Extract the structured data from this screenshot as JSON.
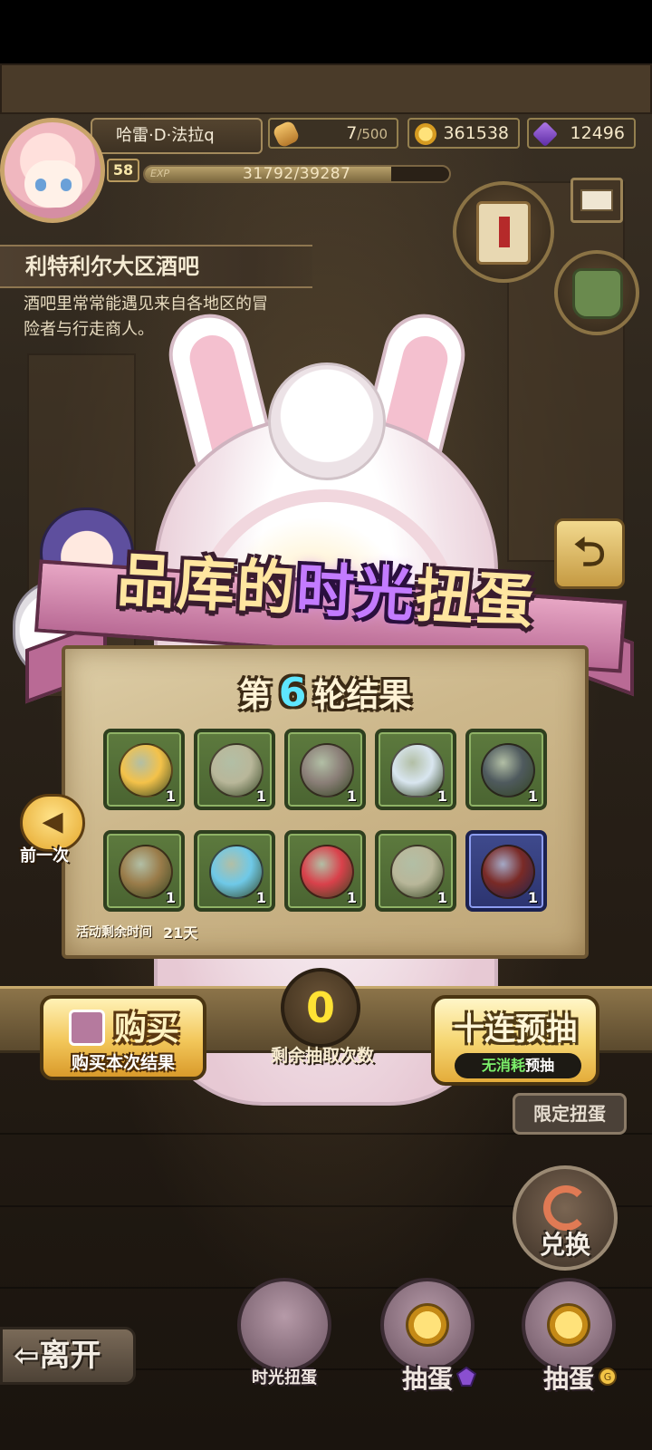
{
  "player": {
    "name": "哈雷·D·法拉q",
    "level": "58",
    "exp_label": "EXP",
    "exp_text": "31792/39287",
    "exp_fraction": 0.809
  },
  "resources": {
    "stamina": {
      "value": "7",
      "max": "/500",
      "icon": "bread-icon"
    },
    "gold": {
      "value": "361538",
      "icon": "gold-coin-icon"
    },
    "gems": {
      "value": "12496",
      "icon": "purple-gem-icon"
    }
  },
  "location": {
    "name": "利特利尔大区酒吧",
    "description_line1": "酒吧里常常能遇见来自各地区的冒",
    "description_line2": "险者与行走商人。"
  },
  "banner": {
    "part1": "品库的",
    "part2": "时光",
    "part3": "扭蛋"
  },
  "result": {
    "prefix": "第",
    "round": "6",
    "suffix": "轮结果",
    "items": [
      {
        "name": "golden-egg",
        "qty": "1",
        "rare": false,
        "color": "#f4c24a"
      },
      {
        "name": "leaf-shell",
        "qty": "1",
        "rare": false,
        "color": "#b9b79a"
      },
      {
        "name": "fur-hood",
        "qty": "1",
        "rare": false,
        "color": "#8b7f78"
      },
      {
        "name": "glass-flask",
        "qty": "1",
        "rare": false,
        "color": "#d9e6f0"
      },
      {
        "name": "turtle-shell",
        "qty": "1",
        "rare": false,
        "color": "#4f5a5e"
      },
      {
        "name": "wooden-egg",
        "qty": "1",
        "rare": false,
        "color": "#9a7c4a"
      },
      {
        "name": "blue-spiral-egg",
        "qty": "1",
        "rare": false,
        "color": "#6fc9e8"
      },
      {
        "name": "red-egg",
        "qty": "1",
        "rare": false,
        "color": "#d9414b"
      },
      {
        "name": "leaf-shell",
        "qty": "1",
        "rare": false,
        "color": "#b9b79a"
      },
      {
        "name": "flame-fur",
        "qty": "1",
        "rare": true,
        "color": "#7a2a26"
      }
    ],
    "remaining_label": "活动剩余时间",
    "remaining_value": "21天"
  },
  "prev_button": {
    "label": "前一次"
  },
  "buy_button": {
    "title": "购买",
    "subtitle": "购买本次结果"
  },
  "counter": {
    "value": "0",
    "label": "剩余抽取次数"
  },
  "ten_draw_button": {
    "title": "十连预抽",
    "sub_green": "无消耗",
    "sub_rest": "预抽"
  },
  "limited_button": {
    "label": "限定扭蛋"
  },
  "exchange_button": {
    "label": "兑换"
  },
  "leave_button": {
    "label": "离开"
  },
  "bottom_tabs": [
    {
      "label": "时光扭蛋"
    },
    {
      "label": "抽蛋",
      "currency": "purple-gem-icon"
    },
    {
      "label": "抽蛋",
      "currency": "gold-coin-icon"
    }
  ],
  "colors": {
    "accent_gold": "#f2c659",
    "highlight_purple": "#c37bff",
    "round_number": "#5ee6ff",
    "counter_text": "#ffe234"
  }
}
